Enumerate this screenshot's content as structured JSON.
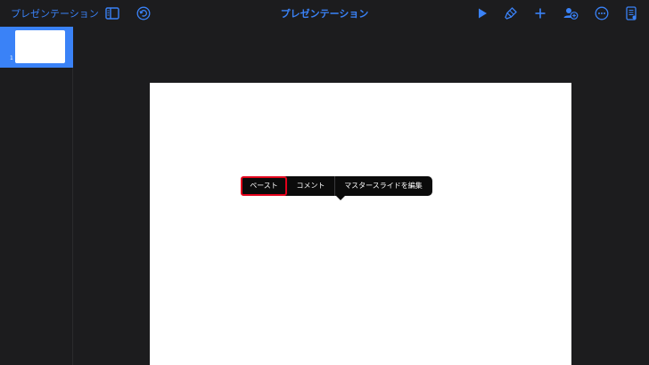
{
  "topbar": {
    "back_label": "プレゼンテーション",
    "title": "プレゼンテーション",
    "icons": {
      "sidebar_toggle": "sidebar-icon",
      "undo": "undo-icon",
      "play": "play-icon",
      "format": "paintbrush-icon",
      "add": "plus-icon",
      "collaborate": "collaborate-icon",
      "more": "more-icon",
      "document": "document-icon"
    }
  },
  "sidebar": {
    "slides": [
      {
        "number": "1"
      }
    ]
  },
  "context_menu": {
    "items": [
      {
        "label": "ペースト"
      },
      {
        "label": "コメント"
      },
      {
        "label": "マスタースライドを編集"
      }
    ]
  },
  "colors": {
    "accent": "#3a82f7",
    "background": "#1c1c1e",
    "slide": "#ffffff",
    "menu": "#0b0b0b",
    "highlight": "#e3001b"
  }
}
